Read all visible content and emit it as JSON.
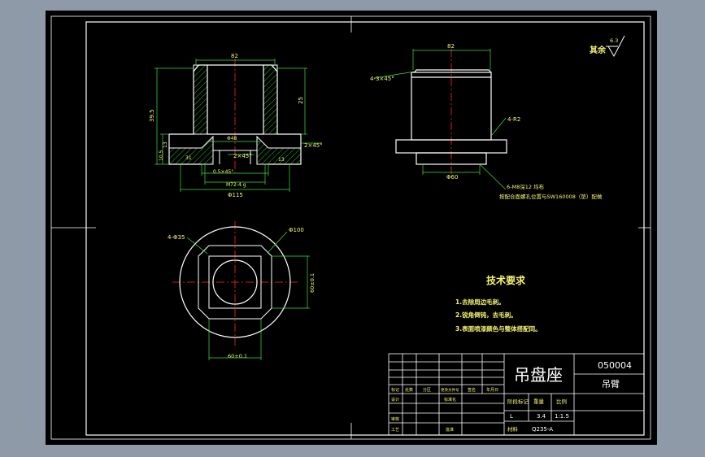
{
  "colors": {
    "background": "#8f9aa9",
    "sheet": "#000000",
    "border": "#ffffff",
    "outline": "#ffffff",
    "dimension": "#3ee23e",
    "centerline": "#ff2a2a",
    "hatch": "#3ee23e",
    "text_yellow": "#f4f470"
  },
  "drawing": {
    "roughness_label": "其余",
    "roughness_value": "6.3",
    "front_view": {
      "dim_top_width": "82",
      "dim_height_total": "39.5",
      "dim_inner_height": "25",
      "dim_bottom_13": "13",
      "dim_bottom_10_5": "10.5",
      "dim_phi48": "Φ48",
      "dim_chamfer_right": "2×45°",
      "dim_chamfer_inner": "2×45°",
      "dim_31": "31",
      "dim_13_side": "13",
      "dim_chamfer_small": "0.5×45°",
      "dim_m72": "M72-4.g",
      "dim_phi115": "Φ115"
    },
    "side_view": {
      "dim_top": "82",
      "dim_chamfer": "4-3×45°",
      "dim_r2": "4-R2",
      "dim_phi60": "Φ60",
      "note_line1": "6-M8深12 均布",
      "note_line2": "按配合面螺孔位置与SW160008（垫）配做"
    },
    "top_view": {
      "dim_holes": "4-Φ35",
      "dim_phi100": "Φ100",
      "dim_side": "60±0.1",
      "dim_bottom": "60±0.1"
    },
    "requirements": {
      "title": "技术要求",
      "items": [
        "1.去除周边毛刺。",
        "2.锐角倒钝，去毛刺。",
        "3.表面喷漆颜色与整体搭配同。"
      ]
    },
    "title_block": {
      "part_name": "吊盘座",
      "drawing_no": "050004",
      "assembly": "吊臂",
      "col_headers": [
        "标记",
        "处数",
        "分区",
        "更改文件号",
        "签名",
        "年月日"
      ],
      "row_labels": [
        "设计",
        "审核",
        "工艺"
      ],
      "std_label": "标准化",
      "approve_label": "批准",
      "stage_header": [
        "阶段标记",
        "重量",
        "比例"
      ],
      "stage_values": [
        "L",
        "3.4",
        "1:1.5"
      ],
      "material_label": "材料",
      "material": "Q235-A"
    }
  }
}
